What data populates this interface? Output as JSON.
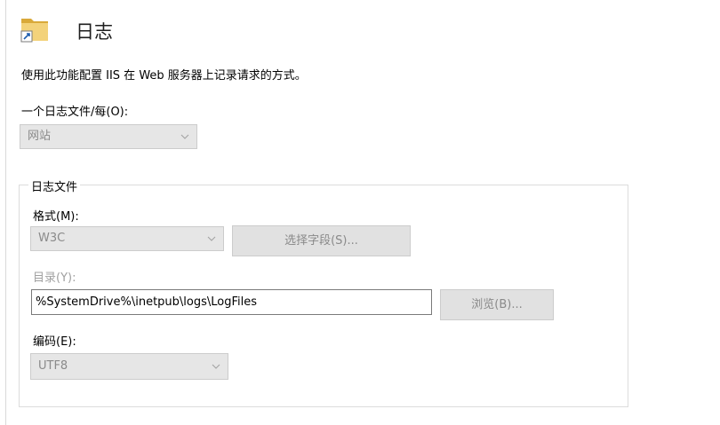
{
  "header": {
    "title": "日志",
    "icon": "folder-shortcut-icon"
  },
  "description": "使用此功能配置 IIS 在 Web 服务器上记录请求的方式。",
  "one_log_per": {
    "label": "一个日志文件/每(O):",
    "value": "网站"
  },
  "log_file_group": {
    "legend": "日志文件",
    "format": {
      "label": "格式(M):",
      "value": "W3C",
      "select_fields_label": "选择字段(S)..."
    },
    "directory": {
      "label": "目录(Y):",
      "value": "%SystemDrive%\\inetpub\\logs\\LogFiles",
      "browse_label": "浏览(B)..."
    },
    "encoding": {
      "label": "编码(E):",
      "value": "UTF8"
    }
  },
  "colors": {
    "disabled_bg": "#e6e6e6",
    "disabled_text": "#8a8a8a",
    "folder": "#e8c25a"
  }
}
